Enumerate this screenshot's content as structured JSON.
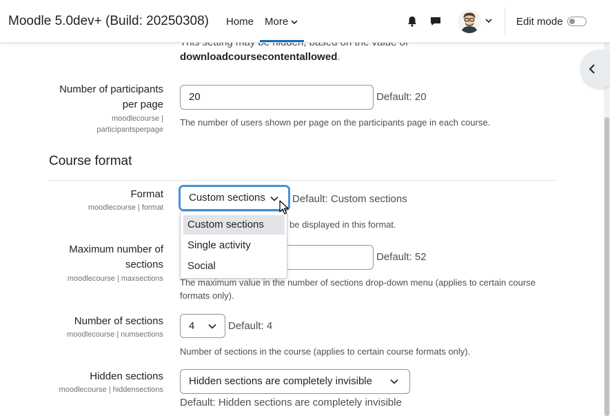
{
  "navbar": {
    "brand": "Moodle 5.0dev+ (Build: 20250308)",
    "home": "Home",
    "more": "More",
    "edit_mode": "Edit mode"
  },
  "top_note": {
    "line1": "This setting may be hidden, based on the value of",
    "bold": "downloadcoursecontentallowed",
    "tail": "."
  },
  "participants": {
    "label_line1": "Number of participants",
    "label_line2": "per page",
    "sub_line1": "moodlecourse |",
    "sub_line2": "participantsperpage",
    "value": "20",
    "default": "Default: 20",
    "desc": "The number of users shown per page on the participants page in each course."
  },
  "section_title": "Course format",
  "format": {
    "label": "Format",
    "sub": "moodlecourse | format",
    "selected": "Custom sections",
    "default": "Default: Custom sections",
    "desc_tail": "be displayed in this format.",
    "options": [
      "Custom sections",
      "Single activity",
      "Social"
    ]
  },
  "maxsections": {
    "label_line1": "Maximum number of",
    "label_line2": "sections",
    "sub": "moodlecourse | maxsections",
    "default": "Default: 52",
    "desc_line1": "The maximum value in the number of sections drop-down menu (applies to certain course",
    "desc_line2": "formats only)."
  },
  "numsections": {
    "label": "Number of sections",
    "sub": "moodlecourse | numsections",
    "selected": "4",
    "default": "Default: 4",
    "desc": "Number of sections in the course (applies to certain course formats only)."
  },
  "hiddensections": {
    "label": "Hidden sections",
    "sub": "moodlecourse | hiddensections",
    "selected": "Hidden sections are completely invisible",
    "default": "Default: Hidden sections are completely invisible"
  },
  "colors": {
    "accent": "#0f6cbf",
    "focus_ring": "#4a90d9"
  }
}
